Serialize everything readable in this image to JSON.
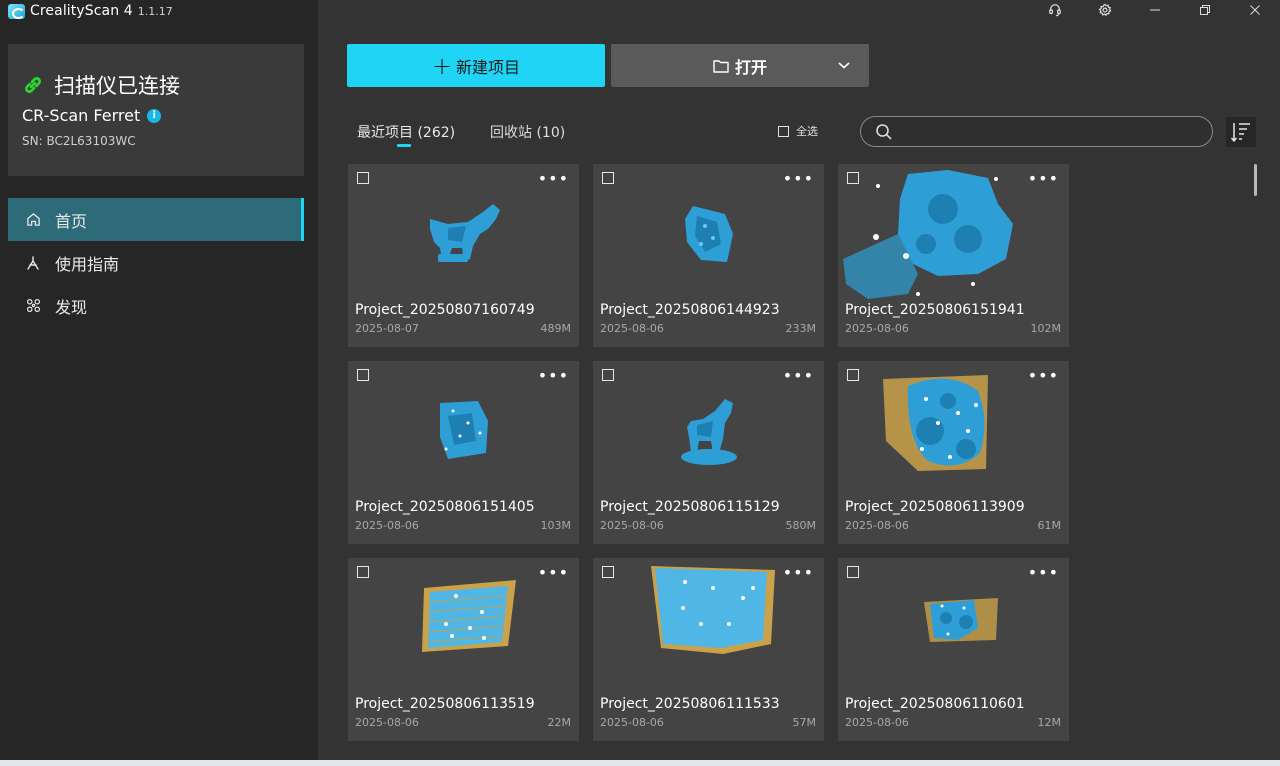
{
  "app": {
    "name": "CrealityScan 4",
    "version": "1.1.17"
  },
  "device": {
    "status": "扫描仪已连接",
    "model": "CR-Scan Ferret",
    "info_glyph": "i",
    "sn": "SN: BC2L63103WC",
    "status_color": "#2bd62b"
  },
  "nav": [
    {
      "label": "首页",
      "icon": "home-icon",
      "active": true
    },
    {
      "label": "使用指南",
      "icon": "guide-icon",
      "active": false
    },
    {
      "label": "发现",
      "icon": "discover-icon",
      "active": false
    }
  ],
  "window_controls": [
    "support-icon",
    "settings-icon",
    "minimize-icon",
    "restore-icon",
    "close-icon"
  ],
  "toolbar": {
    "new_plus": "+",
    "new_label": "新建项目",
    "open_label": "打开"
  },
  "tabs": {
    "recent": "最近项目 (262)",
    "trash": "回收站 (10)"
  },
  "select_all": "全选",
  "search": {
    "placeholder": ""
  },
  "more_glyph": "•••",
  "accent_color": "#1fd4f4",
  "projects": [
    {
      "name": "Project_20250807160749",
      "date": "2025-08-07",
      "size": "489M",
      "thumb": "horse"
    },
    {
      "name": "Project_20250806144923",
      "date": "2025-08-06",
      "size": "233M",
      "thumb": "fragment"
    },
    {
      "name": "Project_20250806151941",
      "date": "2025-08-06",
      "size": "102M",
      "thumb": "shell"
    },
    {
      "name": "Project_20250806151405",
      "date": "2025-08-06",
      "size": "103M",
      "thumb": "small-patch"
    },
    {
      "name": "Project_20250806115129",
      "date": "2025-08-06",
      "size": "580M",
      "thumb": "horse-small"
    },
    {
      "name": "Project_20250806113909",
      "date": "2025-08-06",
      "size": "61M",
      "thumb": "helmet"
    },
    {
      "name": "Project_20250806113519",
      "date": "2025-08-06",
      "size": "22M",
      "thumb": "plate"
    },
    {
      "name": "Project_20250806111533",
      "date": "2025-08-06",
      "size": "57M",
      "thumb": "large-plate"
    },
    {
      "name": "Project_20250806110601",
      "date": "2025-08-06",
      "size": "12M",
      "thumb": "object"
    }
  ]
}
